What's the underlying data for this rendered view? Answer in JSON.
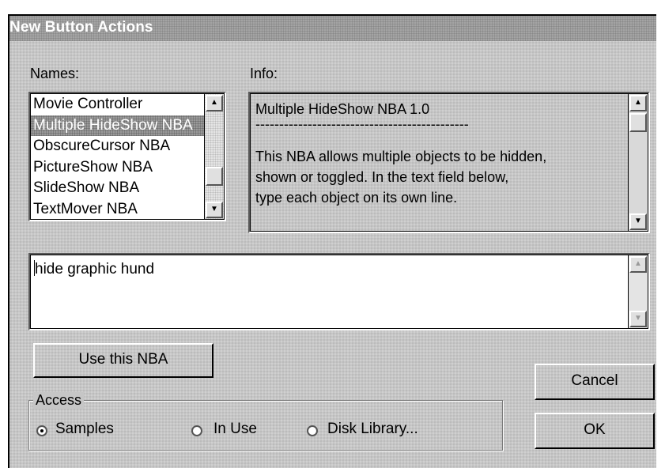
{
  "dialog": {
    "title": "New Button Actions"
  },
  "names": {
    "label": "Names:",
    "items": [
      {
        "label": "Movie Controller",
        "selected": false
      },
      {
        "label": "Multiple HideShow NBA",
        "selected": true
      },
      {
        "label": "ObscureCursor NBA",
        "selected": false
      },
      {
        "label": "PictureShow NBA",
        "selected": false
      },
      {
        "label": "SlideShow NBA",
        "selected": false
      },
      {
        "label": "TextMover NBA",
        "selected": false
      }
    ]
  },
  "info": {
    "label": "Info:",
    "title_line": "Multiple HideShow NBA 1.0",
    "separator": "---------------------------------------------",
    "lines": [
      "This NBA allows multiple objects to be hidden,",
      "shown or toggled.  In the text field below,",
      "type each object on its own line."
    ]
  },
  "text_field": {
    "value": "hide graphic hund"
  },
  "buttons": {
    "use_nba": "Use this NBA",
    "cancel": "Cancel",
    "ok": "OK"
  },
  "access": {
    "legend": "Access",
    "options": [
      {
        "label": "Samples",
        "checked": true
      },
      {
        "label": "In Use",
        "checked": false
      },
      {
        "label": "Disk Library...",
        "checked": false
      }
    ]
  }
}
